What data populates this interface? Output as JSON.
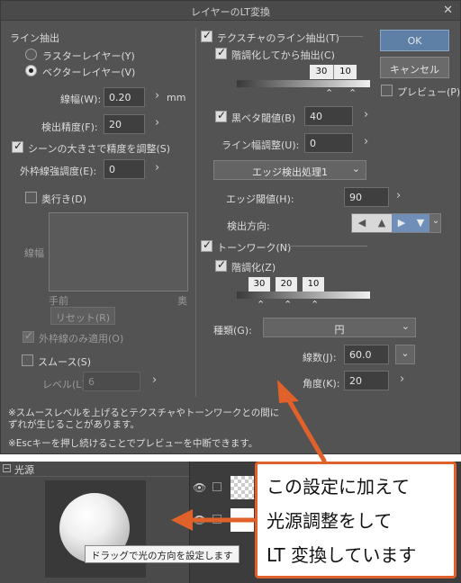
{
  "dialog": {
    "title": "レイヤーのLT変換",
    "close_glyph": "✕",
    "buttons": {
      "ok": "OK",
      "cancel": "キャンセル",
      "preview": "プレビュー(P)"
    },
    "left": {
      "line_extract": "ライン抽出",
      "raster_layer": "ラスターレイヤー(Y)",
      "vector_layer": "ベクターレイヤー(V)",
      "line_width_label": "線幅(W):",
      "line_width_value": "0.20",
      "line_width_unit": "mm",
      "detect_precision_label": "検出精度(F):",
      "detect_precision_value": "20",
      "scene_adjust": "シーンの大きさで精度を調整(S)",
      "outline_strength_label": "外枠線強調度(E):",
      "outline_strength_value": "0",
      "depth": "奥行き(D)",
      "curve_y_label": "線幅",
      "curve_near": "手前",
      "curve_far": "奥",
      "reset": "リセット(R)",
      "outline_only": "外枠線のみ適用(O)",
      "smooth": "スムース(S)",
      "level_label": "レベル(L):",
      "level_value": "6"
    },
    "right": {
      "texture_line": "テクスチャのライン抽出(T)",
      "posterize_extract": "階調化してから抽出(C)",
      "slider1_values": [
        "30",
        "10"
      ],
      "black_threshold_label": "黒ベタ閾値(B)",
      "black_threshold_value": "40",
      "line_width_adjust_label": "ライン幅調整(U):",
      "line_width_adjust_value": "0",
      "edge_process": "エッジ検出処理1",
      "edge_threshold_label": "エッジ閾値(H):",
      "edge_threshold_value": "90",
      "detect_direction_label": "検出方向:",
      "tone_work": "トーンワーク(N)",
      "posterize": "階調化(Z)",
      "slider2_values": [
        "30",
        "20",
        "10"
      ],
      "type_label": "種類(G):",
      "type_value": "円",
      "lines_label": "線数(J):",
      "lines_value": "60.0",
      "angle_label": "角度(K):",
      "angle_value": "20"
    },
    "notes": [
      "※スムースレベルを上げるとテクスチャやトーンワークとの間に",
      "ずれが生じることがあります。",
      "※Escキーを押し続けることでプレビューを中断できます。"
    ]
  },
  "light_panel": {
    "title": "光源",
    "tooltip": "ドラッグで光の方向を設定します"
  },
  "annotation": {
    "lines": [
      "この設定に加えて",
      "光源調整をして",
      "LT 変換しています"
    ],
    "color": "#e1612a"
  }
}
